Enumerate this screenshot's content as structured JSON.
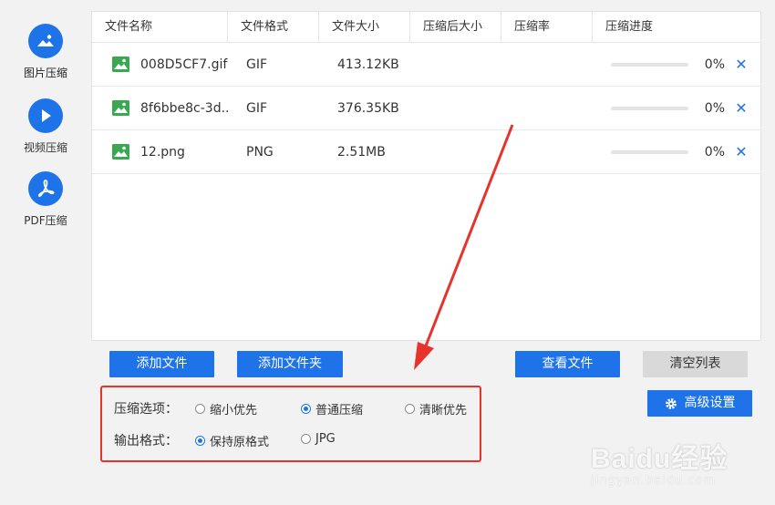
{
  "sidebar": {
    "items": [
      {
        "label": "图片压缩",
        "icon": "image-icon",
        "active": true
      },
      {
        "label": "视频压缩",
        "icon": "play-icon",
        "active": false
      },
      {
        "label": "PDF压缩",
        "icon": "pdf-icon",
        "active": false
      }
    ]
  },
  "table": {
    "headers": [
      "文件名称",
      "文件格式",
      "文件大小",
      "压缩后大小",
      "压缩率",
      "压缩进度"
    ],
    "rows": [
      {
        "name": "008D5CF7.gif",
        "format": "GIF",
        "size": "413.12KB",
        "after": "",
        "rate": "",
        "progress": "0%",
        "progress_value": 0
      },
      {
        "name": "8f6bbe8c-3d...",
        "format": "GIF",
        "size": "376.35KB",
        "after": "",
        "rate": "",
        "progress": "0%",
        "progress_value": 0
      },
      {
        "name": "12.png",
        "format": "PNG",
        "size": "2.51MB",
        "after": "",
        "rate": "",
        "progress": "0%",
        "progress_value": 0
      }
    ]
  },
  "buttons": {
    "add_file": "添加文件",
    "add_folder": "添加文件夹",
    "view_files": "查看文件",
    "clear_list": "清空列表",
    "advanced": "高级设置"
  },
  "options": {
    "compress_label": "压缩选项：",
    "compress_choices": [
      {
        "label": "缩小优先",
        "selected": false
      },
      {
        "label": "普通压缩",
        "selected": true
      },
      {
        "label": "清晰优先",
        "selected": false
      }
    ],
    "format_label": "输出格式：",
    "format_choices": [
      {
        "label": "保持原格式",
        "selected": true
      },
      {
        "label": "JPG",
        "selected": false
      }
    ]
  },
  "watermark": {
    "logo": "Baidu经验",
    "url": "jingyan.baidu.com"
  },
  "colors": {
    "accent": "#1e73e8",
    "highlight": "#e8332c",
    "arrow": "#e8332c"
  }
}
